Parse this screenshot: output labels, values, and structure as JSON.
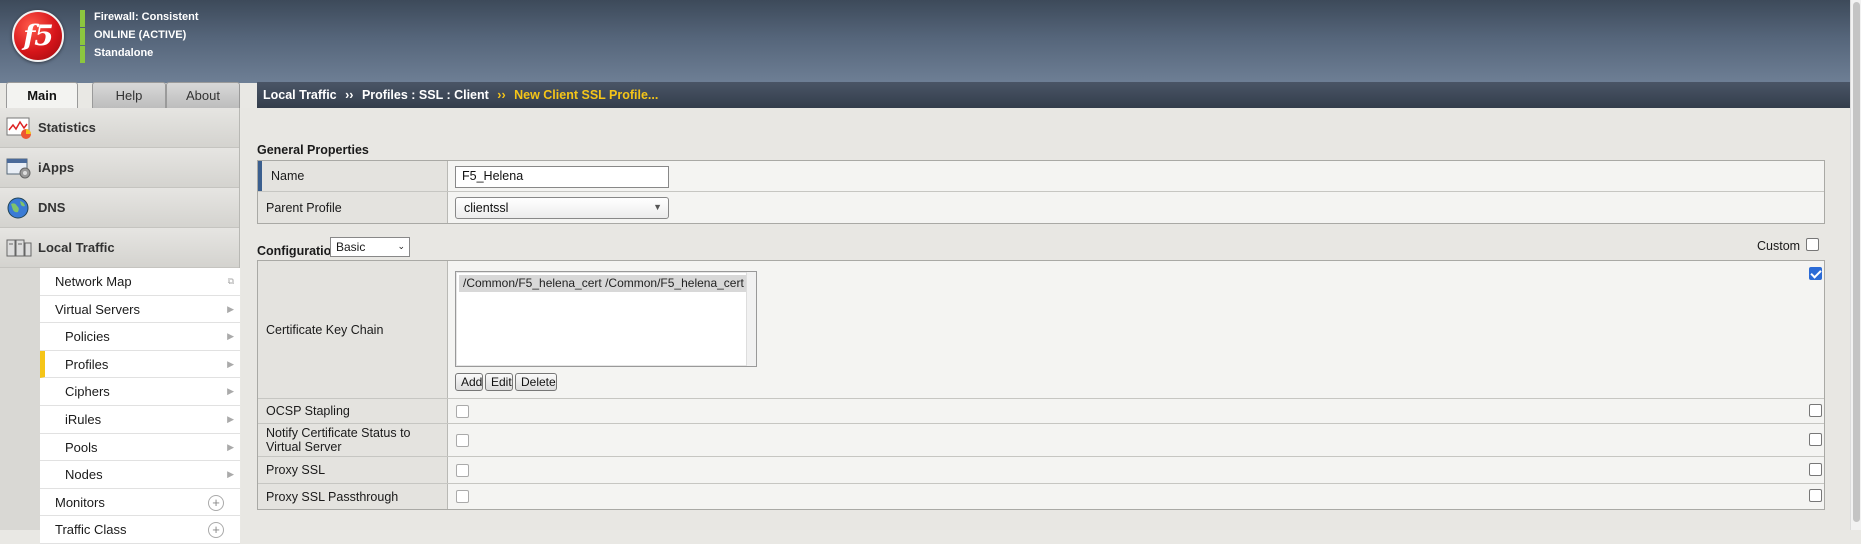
{
  "header": {
    "logo_text": "f5",
    "status": [
      "Firewall: Consistent",
      "ONLINE (ACTIVE)",
      "Standalone"
    ]
  },
  "tabs": [
    {
      "label": "Main",
      "active": true
    },
    {
      "label": "Help",
      "active": false
    },
    {
      "label": "About",
      "active": false
    }
  ],
  "sidebar": {
    "main_items": [
      {
        "label": "Statistics",
        "icon": "statistics-icon"
      },
      {
        "label": "iApps",
        "icon": "iapps-icon"
      },
      {
        "label": "DNS",
        "icon": "dns-globe-icon"
      },
      {
        "label": "Local Traffic",
        "icon": "local-traffic-icon"
      }
    ],
    "sub_items": [
      {
        "label": "Network Map"
      },
      {
        "label": "Virtual Servers"
      },
      {
        "label": "Policies"
      },
      {
        "label": "Profiles",
        "selected": true
      },
      {
        "label": "Ciphers"
      },
      {
        "label": "iRules"
      },
      {
        "label": "Pools"
      },
      {
        "label": "Nodes"
      },
      {
        "label": "Monitors"
      },
      {
        "label": "Traffic Class"
      }
    ]
  },
  "breadcrumb": {
    "parts": [
      "Local Traffic",
      "Profiles : SSL : Client"
    ],
    "current": "New Client SSL Profile...",
    "separator": "››"
  },
  "general": {
    "title": "General Properties",
    "name_label": "Name",
    "name_value": "F5_Helena",
    "parent_label": "Parent Profile",
    "parent_value": "clientssl"
  },
  "config": {
    "label": "Configuration:",
    "value": "Basic",
    "custom_label": "Custom",
    "custom_checked": false
  },
  "cert_chain": {
    "label": "Certificate Key Chain",
    "entries": [
      "/Common/F5_helena_cert /Common/F5_helena_cert"
    ],
    "add": "Add",
    "edit": "Edit",
    "delete": "Delete",
    "custom_checked": true
  },
  "options": [
    {
      "label": "OCSP Stapling",
      "checked": false
    },
    {
      "label": "Notify Certificate Status to Virtual Server",
      "checked": false
    },
    {
      "label": "Proxy SSL",
      "checked": false
    },
    {
      "label": "Proxy SSL Passthrough",
      "checked": false
    }
  ],
  "colors": {
    "accent": "#f5c518",
    "status_green": "#8cc63f",
    "focus_blue": "#3b5f8e",
    "logo_red": "#d6151a"
  }
}
